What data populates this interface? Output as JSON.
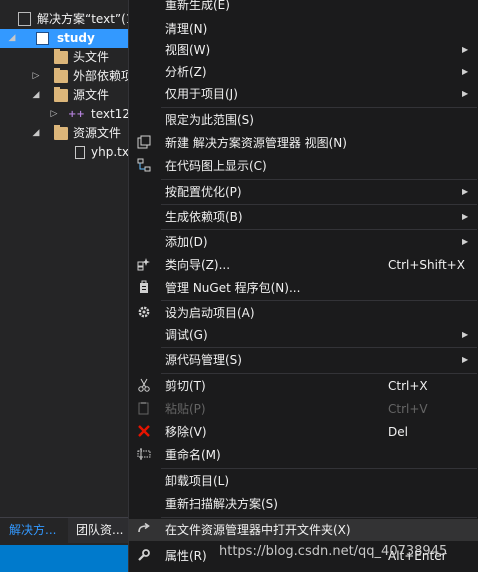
{
  "solution_explorer": {
    "items": [
      {
        "label": "解决方案“text”(1",
        "icon": "solution-icon"
      },
      {
        "label": "study",
        "icon": "project-icon"
      },
      {
        "label": "头文件",
        "icon": "folder-icon"
      },
      {
        "label": "外部依赖项",
        "icon": "folder-icon"
      },
      {
        "label": "源文件",
        "icon": "folder-icon"
      },
      {
        "label": "text12",
        "icon": "cpp-file-icon"
      },
      {
        "label": "资源文件",
        "icon": "folder-icon"
      },
      {
        "label": "yhp.tx",
        "icon": "text-file-icon"
      }
    ],
    "tabs": [
      "解决方...",
      "团队资..."
    ]
  },
  "context_menu": {
    "items": [
      {
        "label": "重新生成(E)"
      },
      {
        "label": "清理(N)"
      },
      {
        "label": "视图(W)",
        "submenu": true
      },
      {
        "label": "分析(Z)",
        "submenu": true
      },
      {
        "label": "仅用于项目(J)",
        "submenu": true
      },
      {
        "label": "限定为此范围(S)"
      },
      {
        "label": "新建 解决方案资源管理器 视图(N)",
        "icon": "new-view-icon"
      },
      {
        "label": "在代码图上显示(C)",
        "icon": "code-map-icon"
      },
      {
        "label": "按配置优化(P)",
        "submenu": true
      },
      {
        "label": "生成依赖项(B)",
        "submenu": true
      },
      {
        "label": "添加(D)",
        "submenu": true
      },
      {
        "label": "类向导(Z)...",
        "shortcut": "Ctrl+Shift+X",
        "icon": "class-wizard-icon"
      },
      {
        "label": "管理 NuGet 程序包(N)...",
        "icon": "nuget-icon"
      },
      {
        "label": "设为启动项目(A)",
        "icon": "gear-icon"
      },
      {
        "label": "调试(G)",
        "submenu": true
      },
      {
        "label": "源代码管理(S)",
        "submenu": true
      },
      {
        "label": "剪切(T)",
        "shortcut": "Ctrl+X",
        "icon": "scissors-icon"
      },
      {
        "label": "粘贴(P)",
        "shortcut": "Ctrl+V",
        "icon": "paste-icon",
        "disabled": true
      },
      {
        "label": "移除(V)",
        "shortcut": "Del",
        "icon": "close-icon",
        "icon_color": "#e51400"
      },
      {
        "label": "重命名(M)",
        "icon": "rename-icon"
      },
      {
        "label": "卸载项目(L)"
      },
      {
        "label": "重新扫描解决方案(S)"
      },
      {
        "label": "在文件资源管理器中打开文件夹(X)",
        "icon": "open-folder-icon",
        "highlighted": true
      },
      {
        "label": "属性(R)",
        "shortcut": "Alt+Enter",
        "icon": "wrench-icon"
      }
    ]
  },
  "watermark": "https://blog.csdn.net/qq_40738945",
  "colors": {
    "accent": "#3399ff",
    "status_bar": "#007acc",
    "menu_bg": "#1b1b1c",
    "panel_bg": "#252526"
  }
}
